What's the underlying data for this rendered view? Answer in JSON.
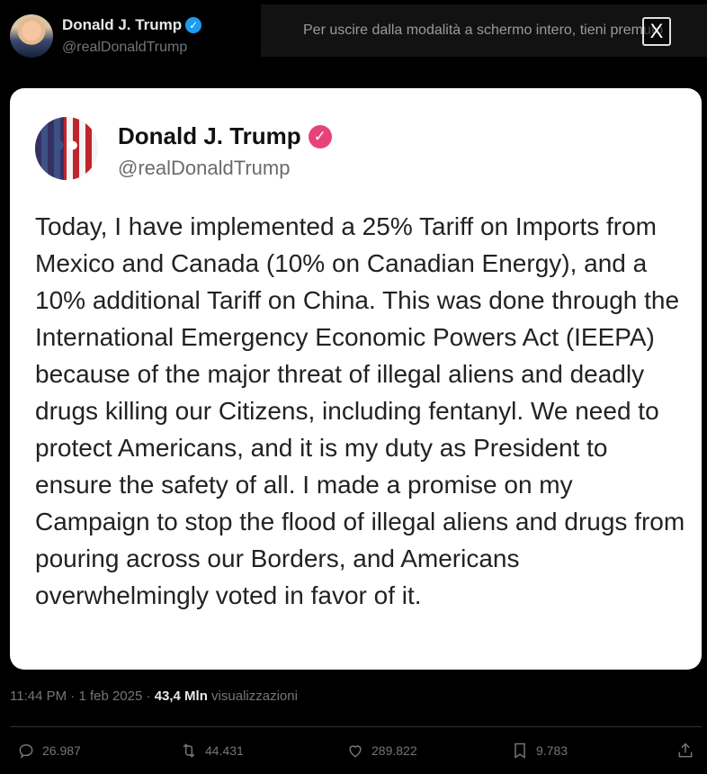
{
  "header": {
    "author_name": "Donald J. Trump",
    "author_handle": "@realDonaldTrump"
  },
  "fullscreen_banner": {
    "text": "Per uscire dalla modalità a schermo intero, tieni premuto",
    "close_label": "X"
  },
  "embedded_post": {
    "author_name": "Donald J. Trump",
    "author_handle": "@realDonaldTrump",
    "body": "Today, I have implemented a 25% Tariff on Imports from Mexico and Canada (10% on Canadian Energy), and a 10% additional Tariff on China. This was done through the International Emergency Economic Powers Act (IEEPA) because of the major threat of illegal aliens and deadly drugs killing our Citizens, including fentanyl. We need to protect Americans, and it is my duty as President to ensure the safety of all. I made a promise on my Campaign to stop the flood of illegal aliens and drugs from pouring across our Borders, and Americans overwhelmingly voted in favor of it."
  },
  "meta": {
    "time": "11:44 PM",
    "separator": "·",
    "date": "1 feb 2025",
    "views_count": "43,4 Mln",
    "views_label": "visualizzazioni"
  },
  "actions": {
    "replies": "26.987",
    "reposts": "44.431",
    "likes": "289.822",
    "bookmarks": "9.783"
  },
  "colors": {
    "background": "#000000",
    "verified_blue": "#1d9bf0",
    "verified_pink": "#e8427a",
    "muted_text": "#71767b"
  }
}
